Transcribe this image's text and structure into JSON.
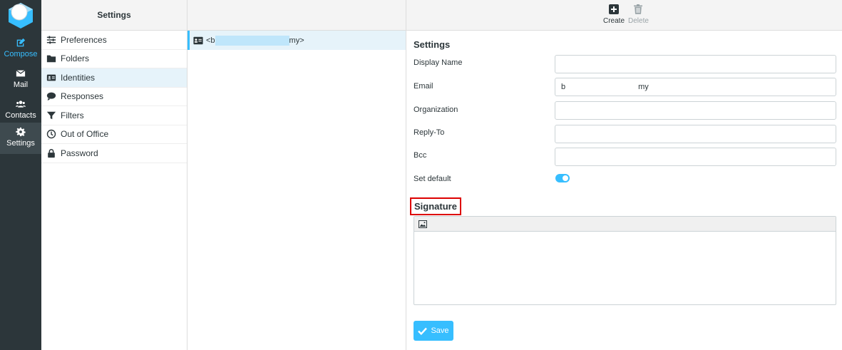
{
  "rail": {
    "items": [
      {
        "label": "Compose",
        "icon": "compose-icon",
        "active_color": "#37beff"
      },
      {
        "label": "Mail",
        "icon": "mail-icon"
      },
      {
        "label": "Contacts",
        "icon": "contacts-icon"
      },
      {
        "label": "Settings",
        "icon": "gear-icon"
      }
    ]
  },
  "nav": {
    "title": "Settings",
    "items": [
      {
        "label": "Preferences",
        "icon": "sliders-icon"
      },
      {
        "label": "Folders",
        "icon": "folder-icon"
      },
      {
        "label": "Identities",
        "icon": "id-card-icon",
        "selected": true
      },
      {
        "label": "Responses",
        "icon": "comment-icon"
      },
      {
        "label": "Filters",
        "icon": "filter-icon"
      },
      {
        "label": "Out of Office",
        "icon": "clock-icon"
      },
      {
        "label": "Password",
        "icon": "lock-icon"
      }
    ]
  },
  "identities": {
    "rows": [
      {
        "prefix": "<b",
        "suffix": "my>"
      }
    ]
  },
  "toolbar": {
    "create_label": "Create",
    "delete_label": "Delete"
  },
  "form": {
    "section_title": "Settings",
    "fields": [
      {
        "label": "Display Name",
        "value": ""
      },
      {
        "label": "Email",
        "value_start": "b",
        "value_end": "my"
      },
      {
        "label": "Organization",
        "value": ""
      },
      {
        "label": "Reply-To",
        "value": ""
      },
      {
        "label": "Bcc",
        "value": ""
      }
    ],
    "set_default_label": "Set default",
    "set_default_on": true
  },
  "signature": {
    "title": "Signature"
  },
  "save_label": "Save",
  "colors": {
    "accent": "#37beff",
    "rail_bg": "#2c363a",
    "selected_bg": "#e6f3fa",
    "highlight_border": "#dd0000"
  }
}
